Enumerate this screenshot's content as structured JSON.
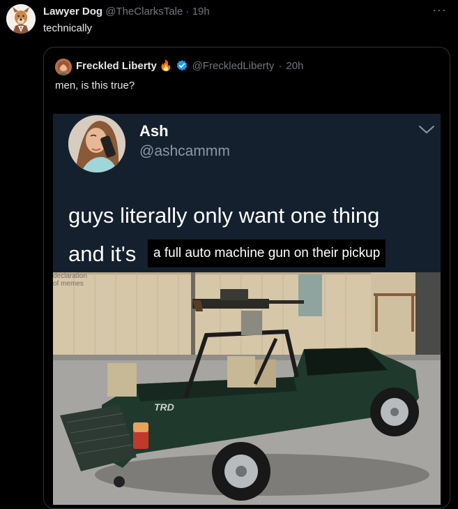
{
  "tweet": {
    "author_name": "Lawyer Dog",
    "author_handle": "@TheClarksTale",
    "separator": "·",
    "time": "19h",
    "text": "technically",
    "more_icon": "more-options-icon"
  },
  "quote": {
    "author_name": "Freckled Liberty",
    "emoji": "🔥",
    "author_handle": "@FreckledLiberty",
    "separator": "·",
    "time": "20h",
    "text": "men, is this true?",
    "verified_color": "#1d9bf0"
  },
  "meme": {
    "name": "Ash",
    "handle": "@ashcammm",
    "line1": "guys literally only want one thing",
    "line2": "and it's",
    "caption": "a full auto machine gun on their pickup",
    "watermark_1": "declaration",
    "watermark_2": "of memes",
    "truck_badge": "TRD",
    "background_color": "#14202e"
  }
}
